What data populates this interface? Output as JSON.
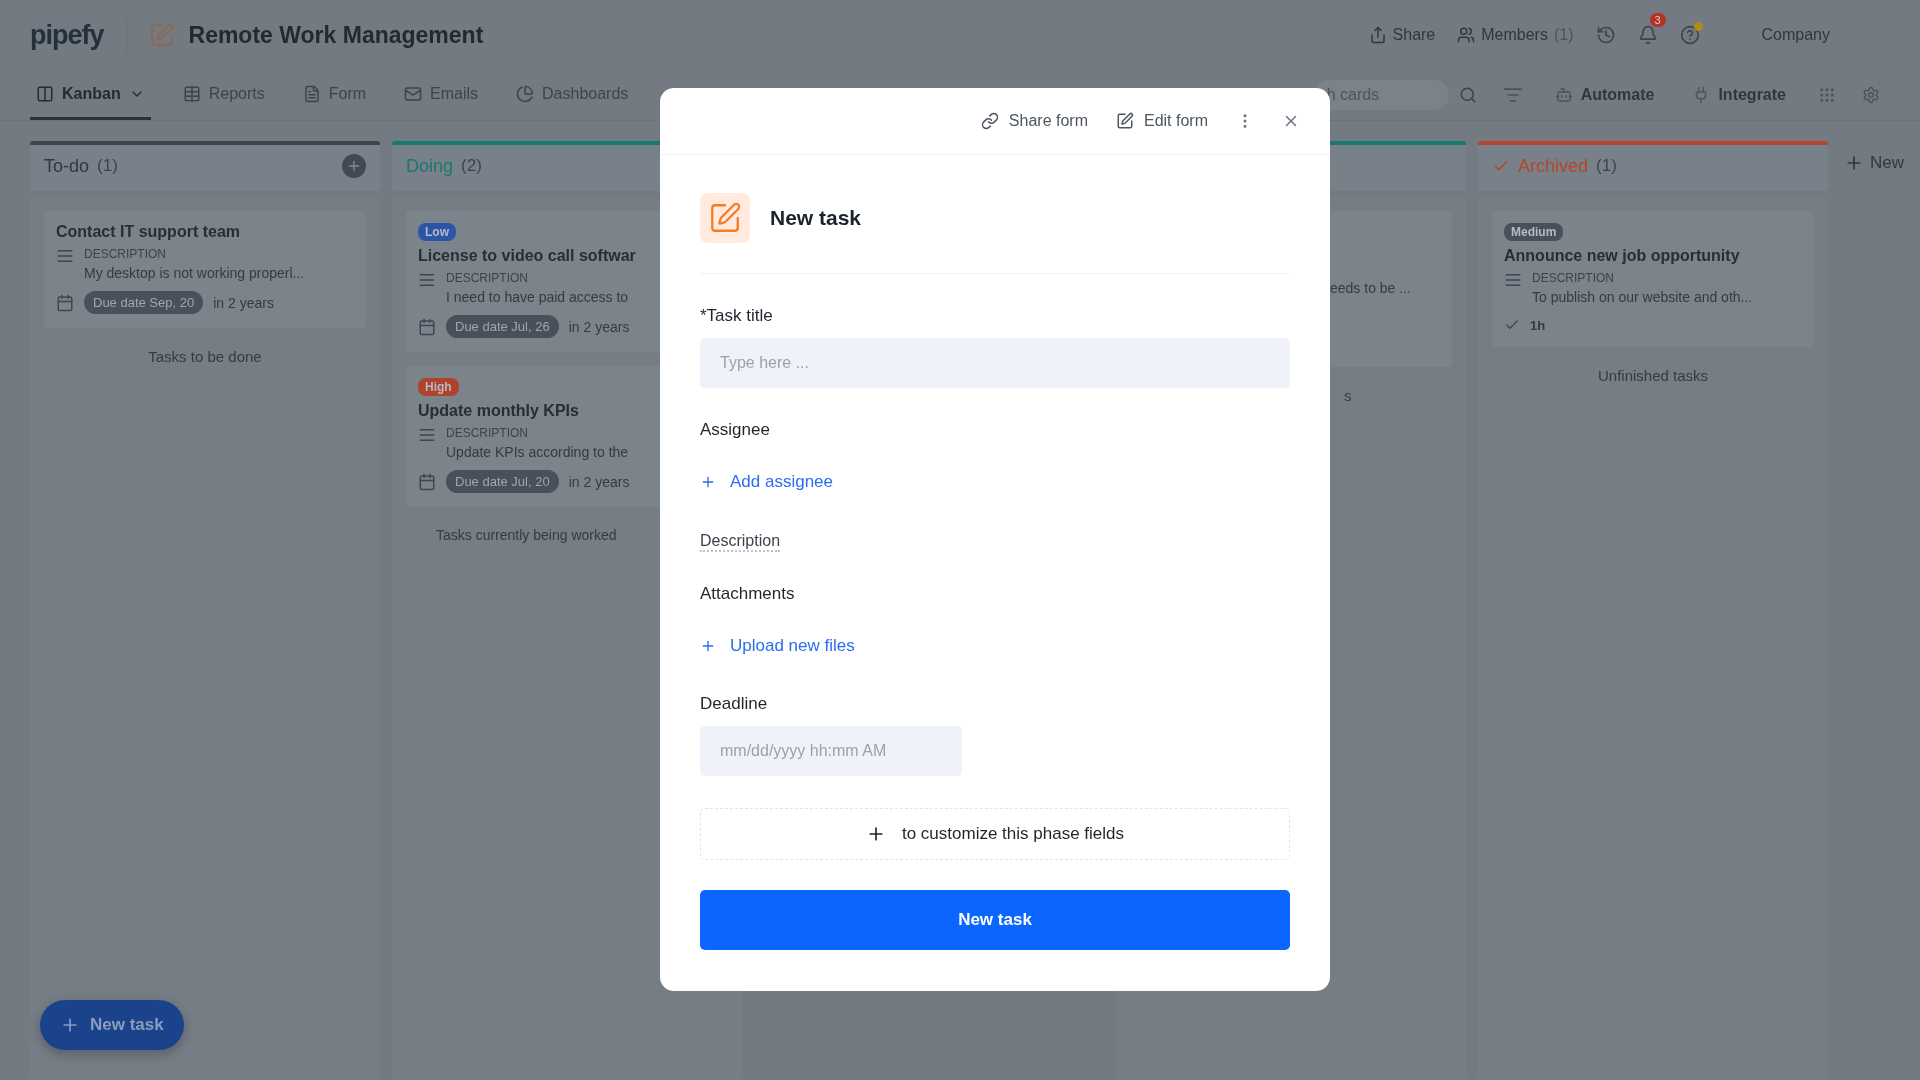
{
  "header": {
    "logo": "pipefy",
    "title": "Remote Work Management",
    "share": "Share",
    "members": {
      "label": "Members",
      "count": "(1)"
    },
    "notifications": "3",
    "help_dot": true,
    "company": "Company"
  },
  "view_tabs": [
    {
      "label": "Kanban",
      "selected": true
    },
    {
      "label": "Reports",
      "selected": false
    },
    {
      "label": "Form",
      "selected": false
    },
    {
      "label": "Emails",
      "selected": false
    },
    {
      "label": "Dashboards",
      "selected": false
    }
  ],
  "toolbar": {
    "search_placeholder": "h cards",
    "actions": [
      "Automate",
      "Integrate"
    ]
  },
  "phases": [
    {
      "kind": "full",
      "title": "To-do",
      "count": "(1)",
      "color": "#3d454e",
      "add_button": true,
      "footer": "Tasks to be done",
      "cards": [
        {
          "title": "Contact IT support team",
          "description_label": "DESCRIPTION",
          "description": "My desktop is not working properl...",
          "due": "Due date Sep, 20",
          "relative": "in 2 years"
        }
      ]
    },
    {
      "kind": "covered",
      "title": "Doing",
      "count": "(2)",
      "color": "#1b7770",
      "footer": "Tasks currently being worked",
      "cards": [
        {
          "priority": {
            "label": "Low",
            "color": "#2c55a6"
          },
          "title": "License to video call softwar",
          "description_label": "DESCRIPTION",
          "description": "I need to have paid access to",
          "due": "Due date Jul, 26",
          "relative": "in 2 years"
        },
        {
          "priority": {
            "label": "High",
            "color": "#b0412a"
          },
          "title": "Update monthly KPIs",
          "description_label": "DESCRIPTION",
          "description": "Update KPIs according to the",
          "due": "Due date Jul, 20",
          "relative": "in 2 years"
        }
      ]
    },
    {
      "kind": "partial",
      "color": "#1b7770",
      "footer": "s",
      "cards": [
        {
          "description": "eeds to be ..."
        }
      ]
    },
    {
      "kind": "full",
      "title": "Archived",
      "count": "(1)",
      "color": "#b5452b",
      "done": true,
      "footer": "Unfinished tasks",
      "cards": [
        {
          "priority": {
            "label": "Medium",
            "color": "#48515a"
          },
          "title": "Announce new job opportunity",
          "description_label": "DESCRIPTION",
          "description": "To publish on our website and oth...",
          "spent": "1h"
        }
      ]
    }
  ],
  "new_phase": "New",
  "modal": {
    "share": "Share form",
    "edit": "Edit form",
    "title": "New task",
    "fields": [
      {
        "kind": "text",
        "label": "*Task title",
        "placeholder": "Type here ..."
      },
      {
        "kind": "link",
        "label": "Assignee",
        "action": "Add assignee"
      },
      {
        "kind": "section",
        "label": "Description"
      },
      {
        "kind": "link",
        "label": "Attachments",
        "action": "Upload new files"
      },
      {
        "kind": "date",
        "label": "Deadline",
        "placeholder": "mm/dd/yyyy hh:mm AM"
      }
    ],
    "customize": "to customize this phase fields",
    "submit": "New task"
  },
  "fab": "New task"
}
